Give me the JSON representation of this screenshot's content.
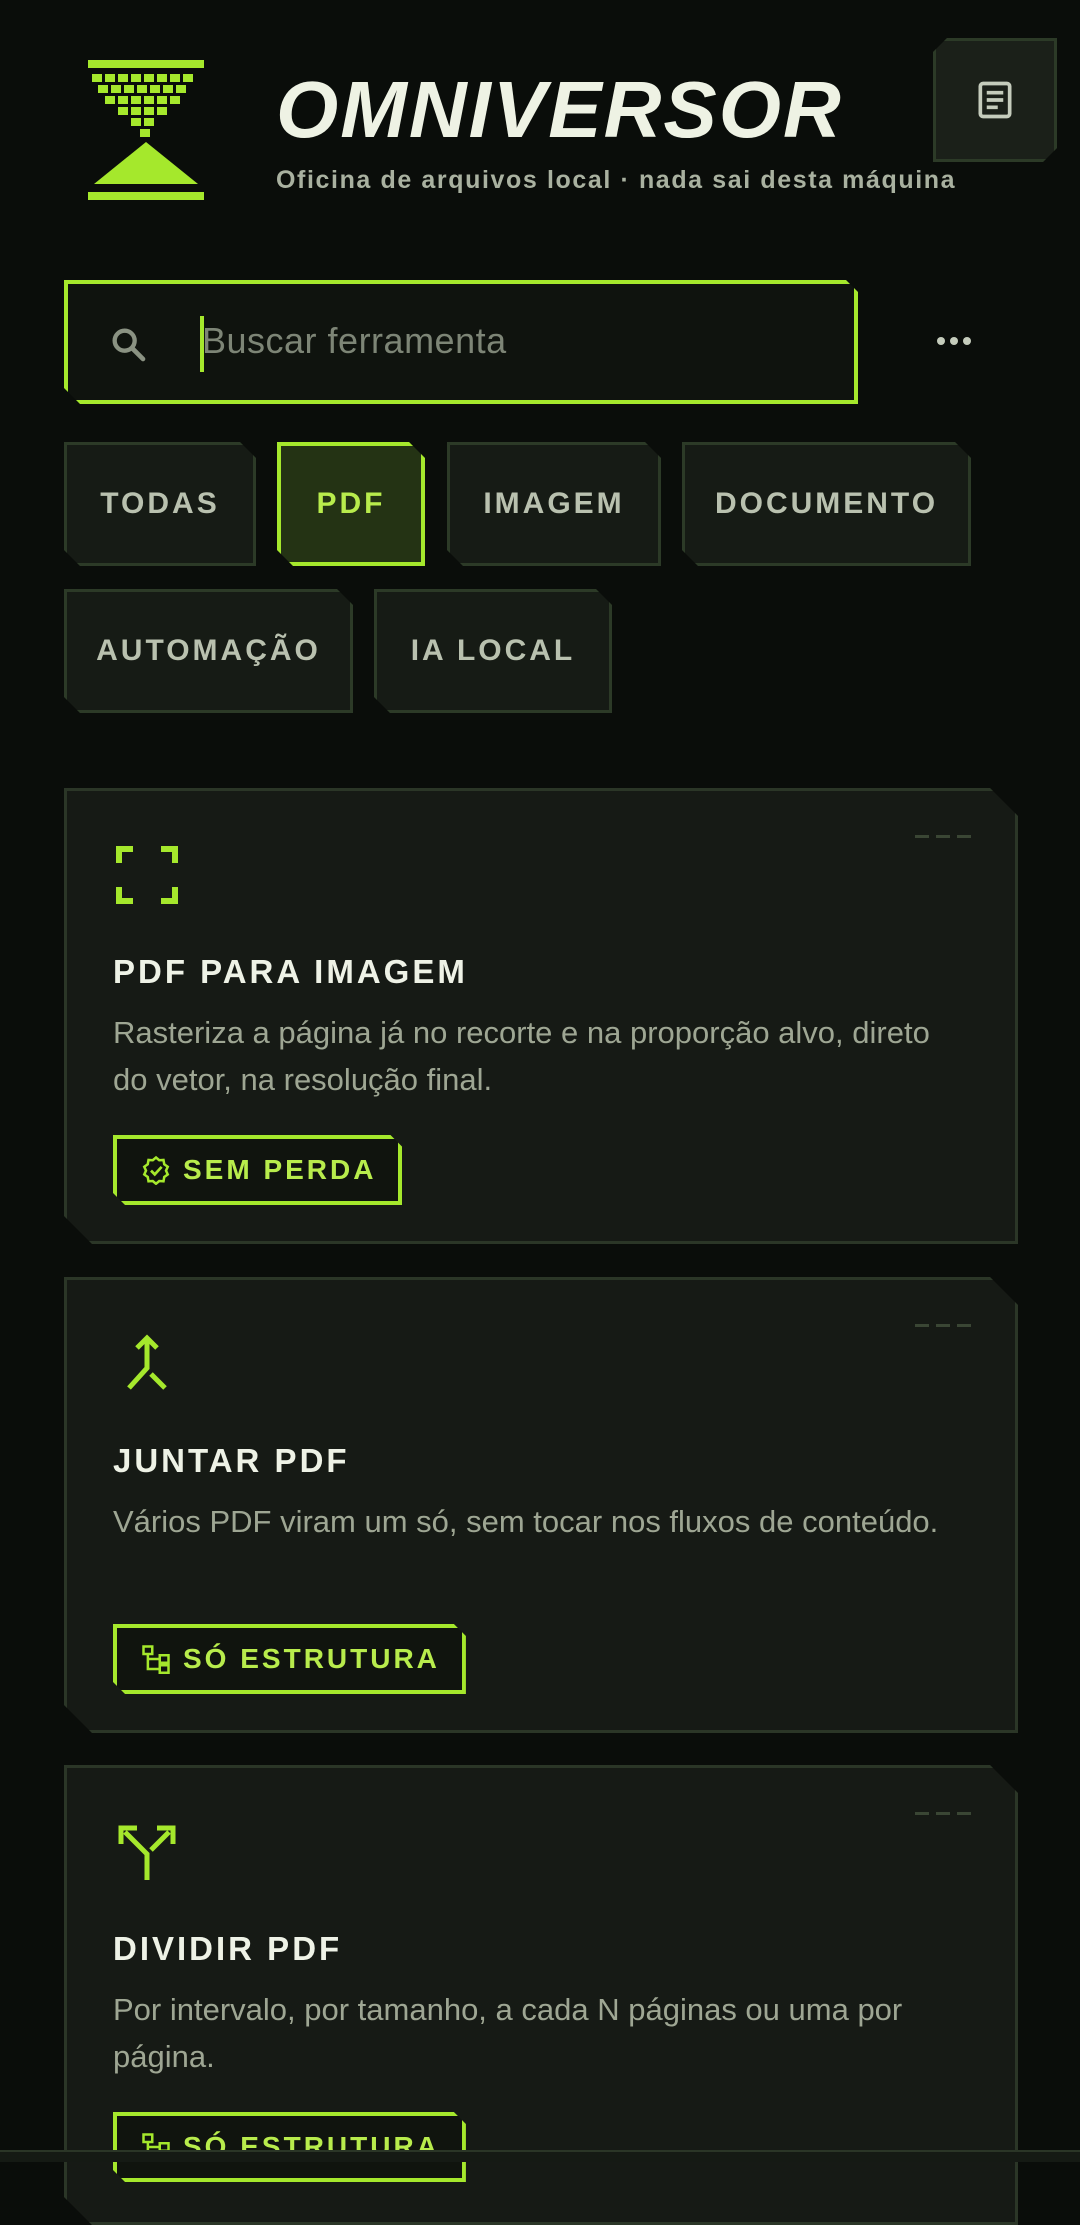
{
  "header": {
    "title": "OMNIVERSOR",
    "subtitle": "Oficina de arquivos local · nada sai desta máquina"
  },
  "search": {
    "placeholder": "Buscar ferramenta"
  },
  "filters": [
    {
      "label": "TODAS",
      "active": false
    },
    {
      "label": "PDF",
      "active": true
    },
    {
      "label": "IMAGEM",
      "active": false
    },
    {
      "label": "DOCUMENTO",
      "active": false
    },
    {
      "label": "AUTOMAÇÃO",
      "active": false
    },
    {
      "label": "IA LOCAL",
      "active": false
    }
  ],
  "tools": [
    {
      "icon": "crop-frame-icon",
      "title": "PDF PARA IMAGEM",
      "description": "Rasteriza a página já no recorte e na proporção alvo, direto do vetor, na resolução final.",
      "badge_icon": "verified-check-icon",
      "badge": "SEM PERDA"
    },
    {
      "icon": "merge-icon",
      "title": "JUNTAR PDF",
      "description": "Vários PDF viram um só, sem tocar nos fluxos de conteúdo.",
      "badge_icon": "structure-tree-icon",
      "badge": "SÓ ESTRUTURA"
    },
    {
      "icon": "split-icon",
      "title": "DIVIDIR PDF",
      "description": "Por intervalo, por tamanho, a cada N páginas ou uma por página.",
      "badge_icon": "structure-tree-icon",
      "badge": "SÓ ESTRUTURA"
    }
  ],
  "colors": {
    "background": "#0a0d0a",
    "accent": "#a5e82c",
    "card": "#161a15",
    "border": "#2b3627"
  }
}
